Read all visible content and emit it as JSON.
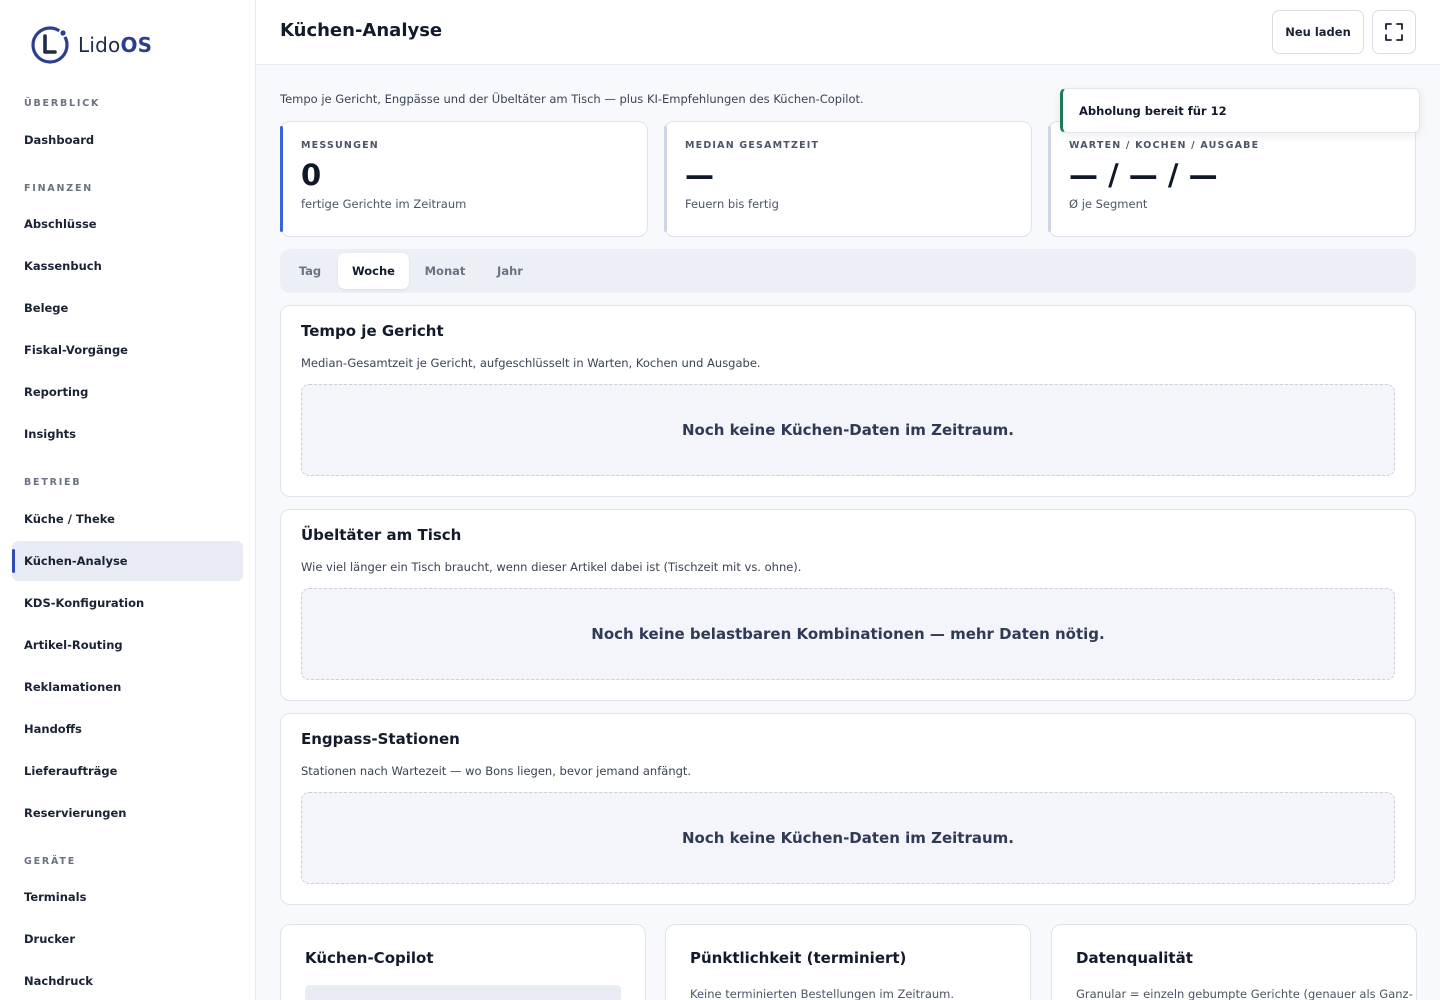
{
  "brand": {
    "name_prefix": "Lido",
    "name_suffix": "OS",
    "accent": "#2c3f8f"
  },
  "sidebar": {
    "sections": {
      "overview": "ÜBERBLICK",
      "finance": "FINANZEN",
      "operations": "BETRIEB",
      "devices": "GERÄTE"
    },
    "items": {
      "dashboard": "Dashboard",
      "abschluesse": "Abschlüsse",
      "kassenbuch": "Kassenbuch",
      "belege": "Belege",
      "fiskal": "Fiskal-Vorgänge",
      "reporting": "Reporting",
      "insights": "Insights",
      "kueche_theke": "Küche / Theke",
      "kuechen_analyse": "Küchen-Analyse",
      "kds_konfiguration": "KDS-Konfiguration",
      "artikel_routing": "Artikel-Routing",
      "reklamationen": "Reklamationen",
      "handoffs": "Handoffs",
      "lieferauftraege": "Lieferaufträge",
      "reservierungen": "Reservierungen",
      "terminals": "Terminals",
      "drucker": "Drucker",
      "nachdruck": "Nachdruck"
    },
    "active_item": "Küchen-Analyse"
  },
  "header": {
    "title": "Küchen-Analyse",
    "reload_label": "Neu laden",
    "fullscreen_icon": "expand-icon"
  },
  "main": {
    "subtitle": "Tempo je Gericht, Engpässe und der Übeltäter am Tisch — plus KI-Empfehlungen des Küchen-Copilot.",
    "toast": "Abholung bereit für 12",
    "kpis": {
      "measurements": {
        "label": "MESSUNGEN",
        "value": "0",
        "sub": "fertige Gerichte im Zeitraum"
      },
      "median": {
        "label": "MEDIAN GESAMTZEIT",
        "value": "—",
        "sub": "Feuern bis fertig"
      },
      "segments": {
        "label": "WARTEN / KOCHEN / AUSGABE",
        "value": "— / — / —",
        "sub": "Ø je Segment"
      }
    },
    "tabs": {
      "day": "Tag",
      "week": "Woche",
      "month": "Monat",
      "year": "Jahr",
      "selected": "Woche"
    },
    "panels": {
      "tempo": {
        "title": "Tempo je Gericht",
        "description": "Median-Gesamtzeit je Gericht, aufgeschlüsselt in Warten, Kochen und Ausgabe.",
        "empty": "Noch keine Küchen-Daten im Zeitraum."
      },
      "culprit": {
        "title": "Übeltäter am Tisch",
        "description": "Wie viel länger ein Tisch braucht, wenn dieser Artikel dabei ist (Tischzeit mit vs. ohne).",
        "empty": "Noch keine belastbaren Kombinationen — mehr Daten nötig."
      },
      "bottleneck": {
        "title": "Engpass-Stationen",
        "description": "Stationen nach Wartezeit — wo Bons liegen, bevor jemand anfängt.",
        "empty": "Noch keine Küchen-Daten im Zeitraum."
      }
    },
    "cards": {
      "copilot": {
        "title": "Küchen-Copilot"
      },
      "punctuality": {
        "title": "Pünktlichkeit (terminiert)",
        "text": "Keine terminierten Bestellungen im Zeitraum."
      },
      "quality": {
        "title": "Datenqualität",
        "text": "Granular = einzeln gebumpte Gerichte (genauer als Ganz-"
      }
    }
  },
  "colors": {
    "active_indicator": "#2f4bb8",
    "kpi_accent": "#3b63d8",
    "toast_accent": "#1e7a5a"
  }
}
